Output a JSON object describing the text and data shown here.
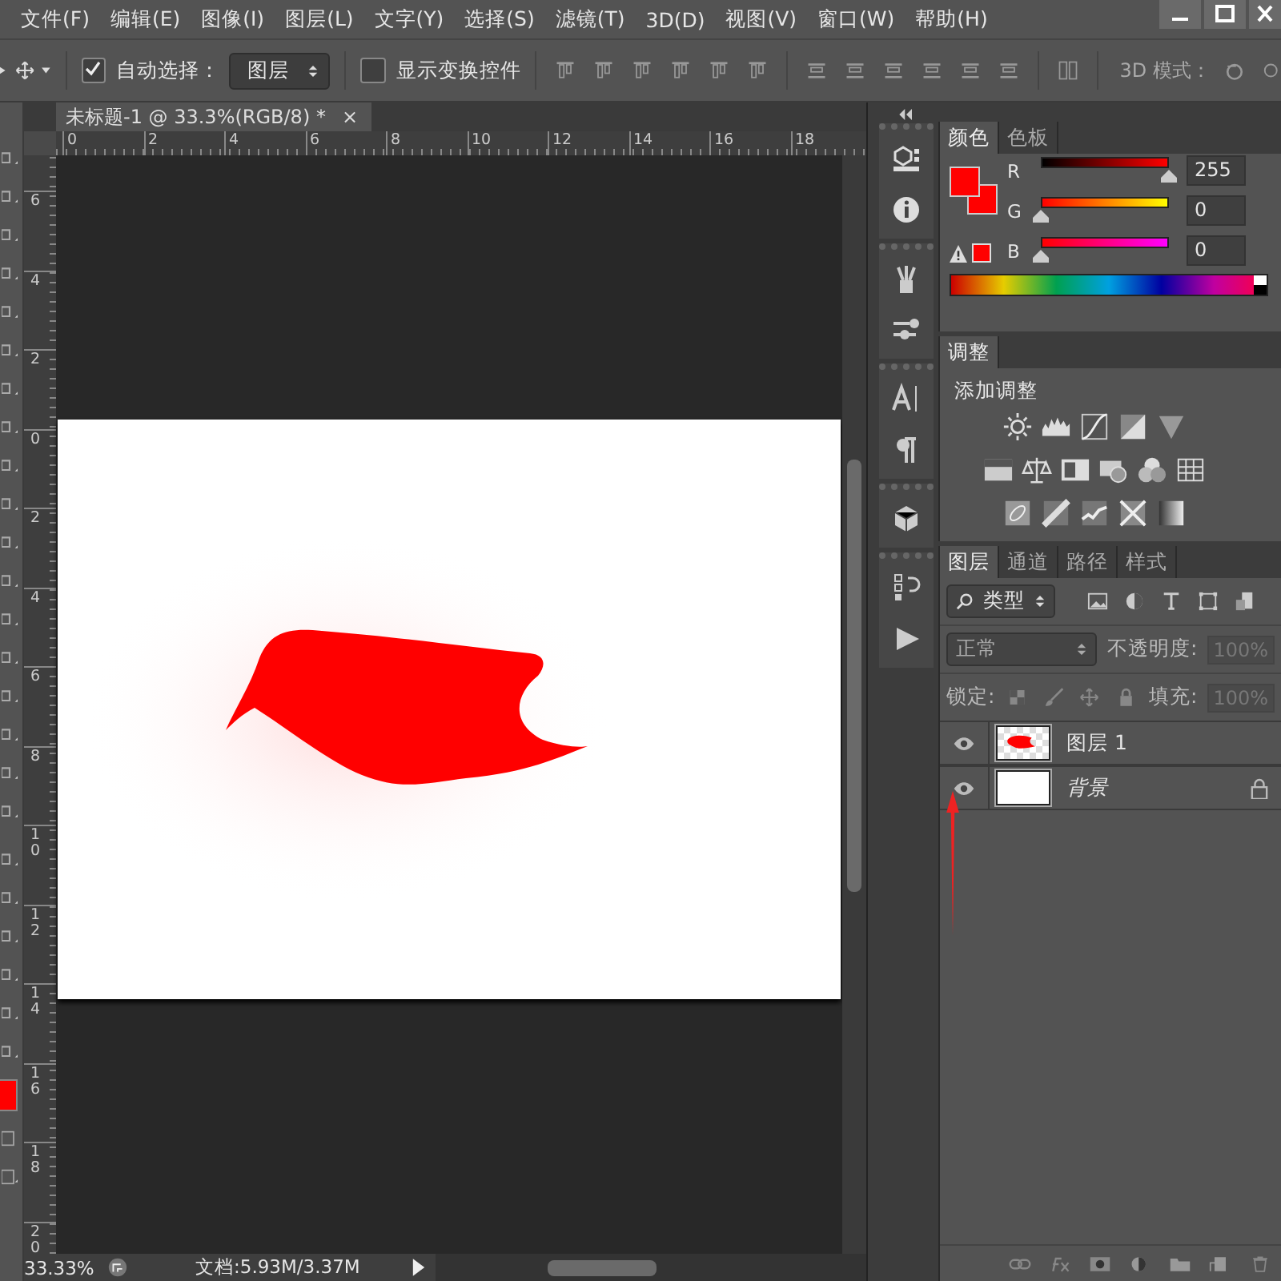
{
  "menu": [
    "文件(F)",
    "编辑(E)",
    "图像(I)",
    "图层(L)",
    "文字(Y)",
    "选择(S)",
    "滤镜(T)",
    "3D(D)",
    "视图(V)",
    "窗口(W)",
    "帮助(H)"
  ],
  "options_bar": {
    "auto_select": {
      "label": "自动选择：",
      "checked": true
    },
    "target": "图层",
    "show_transform": {
      "label": "显示变换控件",
      "checked": false
    },
    "mode_label": "3D 模式："
  },
  "document": {
    "tab": "未标题-1 @ 33.3%(RGB/8) *",
    "close": "×",
    "h_ruler": [
      "0",
      "2",
      "4",
      "6",
      "8",
      "10",
      "12",
      "14",
      "16",
      "18"
    ],
    "v_ruler": [
      "6",
      "4",
      "2",
      "0",
      "2",
      "4",
      "6",
      "8",
      "10",
      "12",
      "14",
      "16",
      "18",
      "20"
    ]
  },
  "status_bar": {
    "zoom": "33.33%",
    "doc_size": "文档:5.93M/3.37M"
  },
  "color_panel": {
    "tabs": [
      {
        "label": "颜色",
        "selected": true
      },
      {
        "label": "色板",
        "selected": false
      }
    ],
    "channels": [
      {
        "label": "R",
        "level": 1,
        "value": "255"
      },
      {
        "label": "G",
        "level": 0,
        "value": "0"
      },
      {
        "label": "B",
        "level": 0,
        "value": "0"
      }
    ]
  },
  "adjust_panel": {
    "tab": "调整",
    "title": "添加调整"
  },
  "layers_panel": {
    "tabs": [
      {
        "label": "图层",
        "selected": true
      },
      {
        "label": "通道",
        "selected": false
      },
      {
        "label": "路径",
        "selected": false
      },
      {
        "label": "样式",
        "selected": false
      }
    ],
    "filter": "类型",
    "blend_mode": "正常",
    "opacity_label": "不透明度:",
    "opacity": "100%",
    "lock_label": "锁定:",
    "fill_label": "填充:",
    "fill": "100%",
    "layers": [
      {
        "name": "图层 1",
        "visible": true,
        "locked": false,
        "kind": "transparent"
      },
      {
        "name": "背景",
        "visible": true,
        "locked": true,
        "kind": "white"
      }
    ]
  }
}
